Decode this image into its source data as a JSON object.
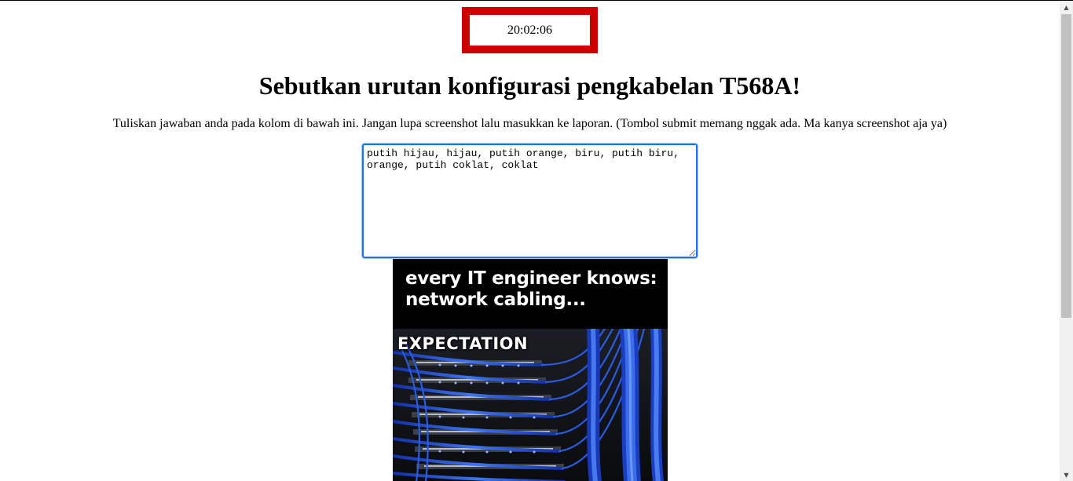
{
  "clock": {
    "time": "20:02:06"
  },
  "question": {
    "title": "Sebutkan urutan konfigurasi pengkabelan T568A!"
  },
  "instructions": {
    "text": "Tuliskan jawaban anda pada kolom di bawah ini. Jangan lupa screenshot lalu masukkan ke laporan. (Tombol submit memang nggak ada. Ma kanya screenshot aja ya)"
  },
  "answer": {
    "value": "putih hijau, hijau, putih orange, biru, putih biru, orange, putih coklat, coklat"
  },
  "meme": {
    "caption": "every IT engineer knows: network cabling...",
    "label": "EXPECTATION"
  },
  "colors": {
    "clock_border": "#cc0000",
    "textarea_focus": "#1a73e8",
    "cable_blue": "#1f4fd1"
  },
  "icons": {
    "scroll_up": "scroll-up-arrow-icon",
    "scroll_down": "scroll-down-arrow-icon"
  }
}
